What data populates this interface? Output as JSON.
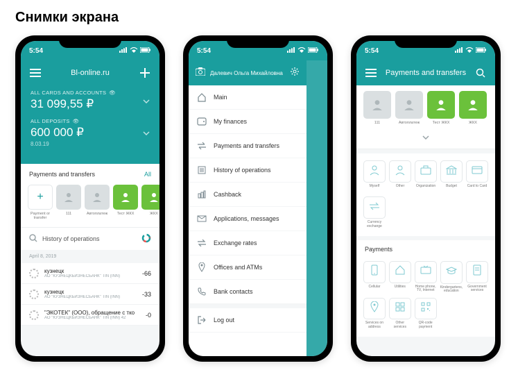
{
  "page_heading": "Снимки экрана",
  "status_time": "5:54",
  "phone1": {
    "header_title": "Bl-online.ru",
    "cards_label": "ALL CARDS AND ACCOUNTS",
    "cards_amount": "31 099,55 ₽",
    "deposits_label": "ALL DEPOSITS",
    "deposits_amount": "600 000 ₽",
    "deposits_sub": "8.03.19",
    "section_title": "Payments and transfers",
    "section_all": "All",
    "tiles": [
      {
        "label": "Payment or transfer",
        "kind": "add"
      },
      {
        "label": "111",
        "kind": "grey"
      },
      {
        "label": "Автоплатеж",
        "kind": "grey"
      },
      {
        "label": "Тест ЖКХ",
        "kind": "green"
      },
      {
        "label": "ЖКХ",
        "kind": "green"
      }
    ],
    "history_title": "History of operations",
    "date": "April 8, 2019",
    "ops": [
      {
        "title": "кузнецк",
        "sub": "АО \"КУЗНЕЦКБИЗНЕСБАНК\" TIN (INN)",
        "amount": "-66"
      },
      {
        "title": "кузнецк",
        "sub": "АО \"КУЗНЕЦКБИЗНЕСБАНК\" TIN (INN)",
        "amount": "-33"
      },
      {
        "title": "\"ЭКОТЕК\" (ООО), обращение с тко",
        "sub": "АО \"КУЗНЕЦКБИЗНЕСБАНК\" TIN (INN) 42",
        "amount": "-0"
      }
    ]
  },
  "phone2": {
    "user_name": "Далевич Ольга Михайловна",
    "menu": [
      "Main",
      "My finances",
      "Payments and transfers",
      "History of operations",
      "Cashback",
      "Applications, messages",
      "Exchange rates",
      "Offices and ATMs",
      "Bank contacts"
    ],
    "logout": "Log out"
  },
  "phone3": {
    "header_title": "Payments and transfers",
    "top_tiles": [
      {
        "label": "111",
        "kind": "grey"
      },
      {
        "label": "Автоплатеж",
        "kind": "grey"
      },
      {
        "label": "Тест ЖКХ",
        "kind": "green"
      },
      {
        "label": "ЖКХ",
        "kind": "green"
      }
    ],
    "group1": [
      "Myself",
      "Other",
      "Organization",
      "Budget",
      "Card to Card"
    ],
    "group1_extra": "Currency exchange",
    "payments_title": "Payments",
    "payments": [
      "Cellular",
      "Utilities",
      "Home phone, TV, Internet",
      "Kindergartens, education",
      "Government services",
      "Services on address",
      "Other services",
      "QR-code payment"
    ]
  }
}
